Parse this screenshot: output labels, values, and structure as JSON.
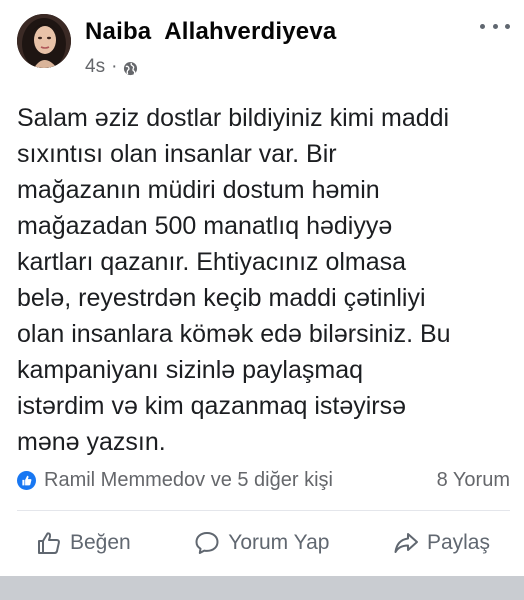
{
  "post": {
    "author": "Naiba  Allahverdiyeva",
    "time": "4s",
    "separator": "·",
    "privacy_icon": "globe-icon",
    "more_icon": "more-dots-icon",
    "lines": [
      "Salam əziz dostlar bildiyiniz kimi maddi",
      "sıxıntısı olan insanlar var. Bir",
      "mağazanın müdiri dostum həmin",
      "mağazadan 500 manatlıq hədiyyə",
      "kartları qazanır. Ehtiyacınız olmasa",
      "belə, reyestrdən keçib maddi çətinliyi",
      "olan insanlara kömək edə bilərsiniz. Bu",
      "kampaniyanı sizinlə paylaşmaq",
      "istərdim və kim qazanmaq istəyirsə",
      "mənə yazsın."
    ],
    "reactions": {
      "icon": "like-reaction-icon",
      "text": "Ramil Memmedov ve 5 diğer kişi",
      "comments": "8 Yorum"
    },
    "actions": {
      "like": "Beğen",
      "comment": "Yorum Yap",
      "share": "Paylaş"
    }
  },
  "colors": {
    "accent": "#1877f2",
    "muted_text": "#65676b",
    "body_text": "#1c1e21"
  }
}
